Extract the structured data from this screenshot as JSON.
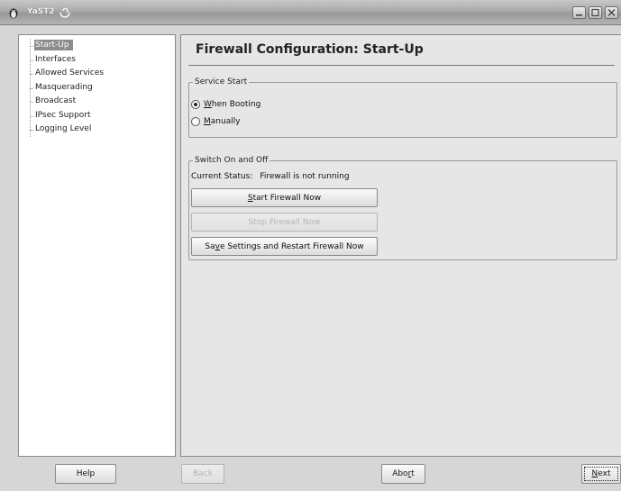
{
  "window": {
    "title": "YaST2",
    "app_icon": "penguin-icon",
    "title_glyph": "yast-swirl-icon",
    "controls": [
      "minimize-icon",
      "maximize-icon",
      "close-icon"
    ]
  },
  "nav": {
    "items": [
      {
        "label": "Start-Up",
        "selected": true
      },
      {
        "label": "Interfaces",
        "selected": false
      },
      {
        "label": "Allowed Services",
        "selected": false
      },
      {
        "label": "Masquerading",
        "selected": false
      },
      {
        "label": "Broadcast",
        "selected": false
      },
      {
        "label": "IPsec Support",
        "selected": false
      },
      {
        "label": "Logging Level",
        "selected": false
      }
    ]
  },
  "main": {
    "title": "Firewall Configuration: Start-Up",
    "service_start": {
      "legend": "Service Start",
      "when_booting": {
        "mnemonic": "W",
        "rest": "hen Booting",
        "checked": true
      },
      "manually": {
        "mnemonic": "M",
        "rest": "anually",
        "checked": false
      }
    },
    "switch": {
      "legend": "Switch On and Off",
      "status_label": "Current Status:",
      "status_value": "Firewall is not running",
      "start_btn": {
        "mnemonic": "S",
        "rest": "tart Firewall Now",
        "enabled": true
      },
      "stop_btn": {
        "label": "Stop Firewall Now",
        "enabled": false
      },
      "save_btn": {
        "pre": "Sa",
        "mnemonic": "v",
        "rest": "e Settings and Restart Firewall Now",
        "enabled": true
      }
    }
  },
  "footer": {
    "help": "Help",
    "back": "Back",
    "abort": {
      "pre": "Abo",
      "mnemonic": "r",
      "rest": "t"
    },
    "next": {
      "mnemonic": "N",
      "rest": "ext"
    }
  },
  "colors": {
    "background": "#d6d6d6",
    "content_bg": "#e6e6e6",
    "selection": "#8c8c8c",
    "disabled_text": "#b5b5b5"
  }
}
